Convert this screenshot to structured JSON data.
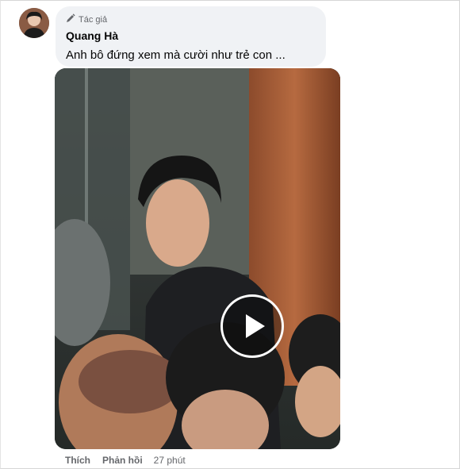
{
  "comment": {
    "badge_label": "Tác giả",
    "author_name": "Quang Hà",
    "text": "Anh bô đứng xem mà cười như trẻ con ...",
    "actions": {
      "like": "Thích",
      "reply": "Phản hồi",
      "time": "27 phút"
    }
  },
  "video": {
    "has_play_button": true
  },
  "icons": {
    "badge": "pencil-icon",
    "play": "play-icon"
  },
  "colors": {
    "bubble_bg": "#f0f2f5",
    "secondary_text": "#65676b",
    "primary_text": "#050505"
  }
}
